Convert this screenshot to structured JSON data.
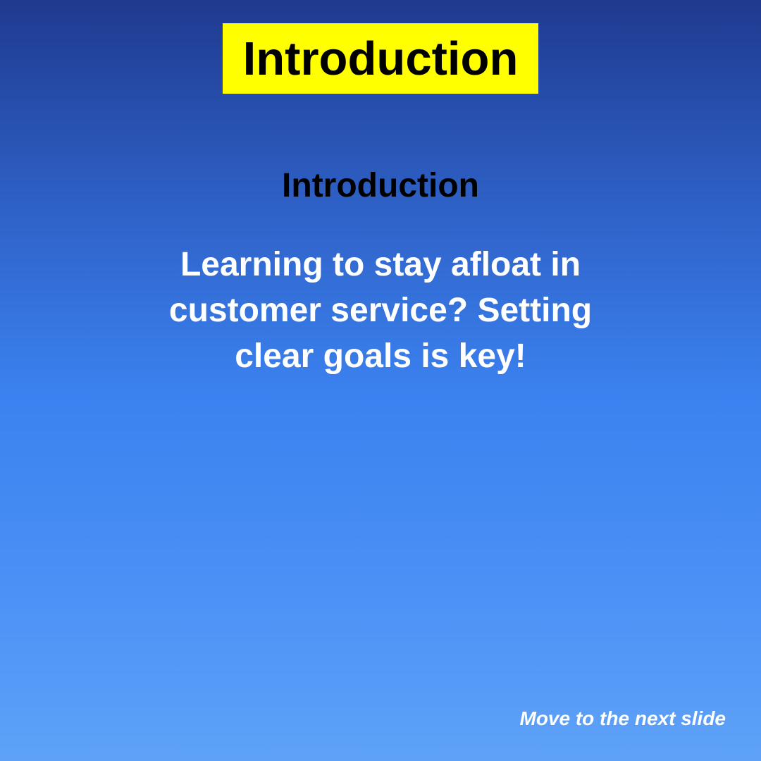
{
  "slide": {
    "title": "Introduction",
    "subheading": "Introduction",
    "body": "Learning to stay afloat in customer service? Setting clear goals is key!",
    "next_label": "Move to the next slide"
  },
  "colors": {
    "title_box": "#ffff00",
    "title_text": "#000000",
    "subheading": "#000000",
    "body_text": "#ffffff",
    "next_link": "#ffffff",
    "gradient_top": "#1f3a8f",
    "gradient_bottom": "#5ea2f8"
  }
}
